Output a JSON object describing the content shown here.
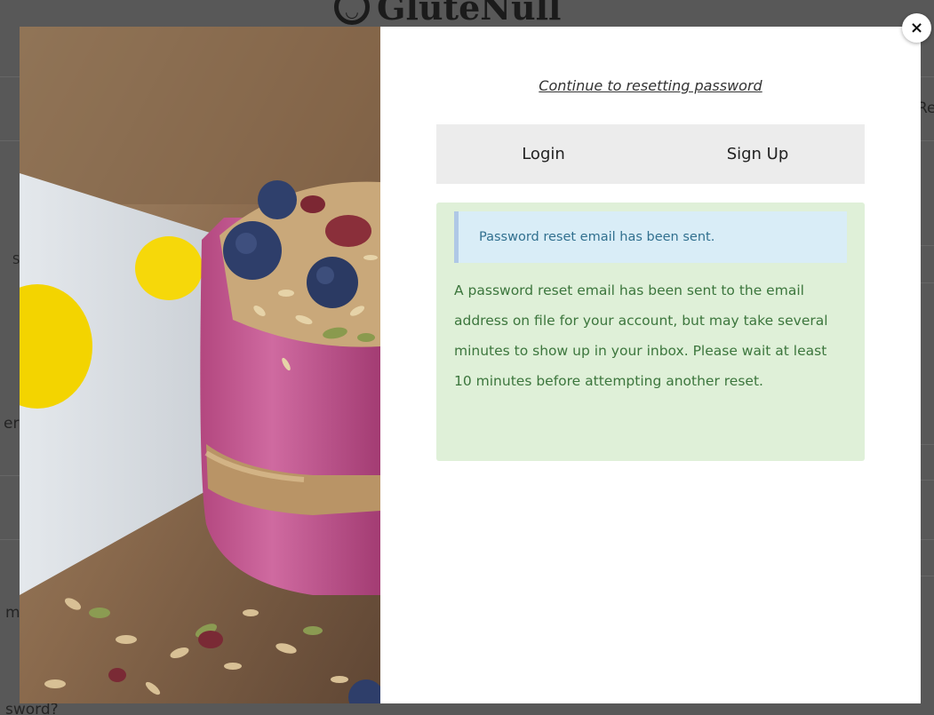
{
  "background": {
    "logo_text": "GluteNull",
    "right_fragment": "Re",
    "left_fragment_1": "S",
    "left_fragment_2": "er",
    "left_fragment_3": "m",
    "bottom_fragment": "sword?"
  },
  "modal": {
    "continue_link": "Continue to resetting password",
    "tabs": [
      {
        "label": "Login"
      },
      {
        "label": "Sign Up"
      }
    ],
    "notice": "Password reset email has been sent.",
    "message": "A password reset email has been sent to the email address on file for your account, but may take several minutes to show up in your inbox. Please wait at least 10 minutes before attempting another reset.",
    "close_label": "×"
  },
  "colors": {
    "overlay": "#585858",
    "tab_bg": "#ececec",
    "success_bg": "#dff0d8",
    "success_text": "#3c763d",
    "notice_bg": "#d9edf7",
    "notice_border": "#afc8e6",
    "notice_text": "#31708f"
  }
}
